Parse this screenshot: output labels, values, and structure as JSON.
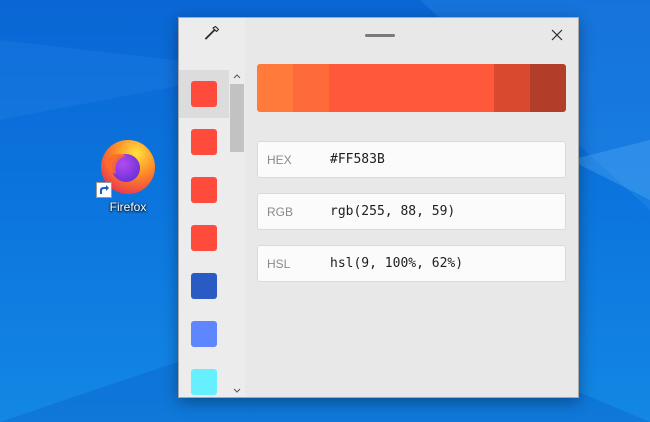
{
  "desktop": {
    "icon_label": "Firefox"
  },
  "picker": {
    "eyedropper_icon": "eyedropper-icon",
    "close_icon": "close-icon",
    "swatches": [
      {
        "color": "#FF4B3B"
      },
      {
        "color": "#FF4B3B"
      },
      {
        "color": "#FF4B3B"
      },
      {
        "color": "#FF4B3B"
      },
      {
        "color": "#2A5BC4"
      },
      {
        "color": "#5E86FF"
      },
      {
        "color": "#66F0FF"
      }
    ],
    "shades": [
      {
        "color": "#FF7A3B"
      },
      {
        "color": "#FF6A3B"
      },
      {
        "color": "#FF583B"
      },
      {
        "color": "#D9492F"
      },
      {
        "color": "#B23E29"
      }
    ],
    "formats": [
      {
        "label": "HEX",
        "value": "#FF583B"
      },
      {
        "label": "RGB",
        "value": "rgb(255, 88, 59)"
      },
      {
        "label": "HSL",
        "value": "hsl(9, 100%, 62%)"
      }
    ]
  }
}
